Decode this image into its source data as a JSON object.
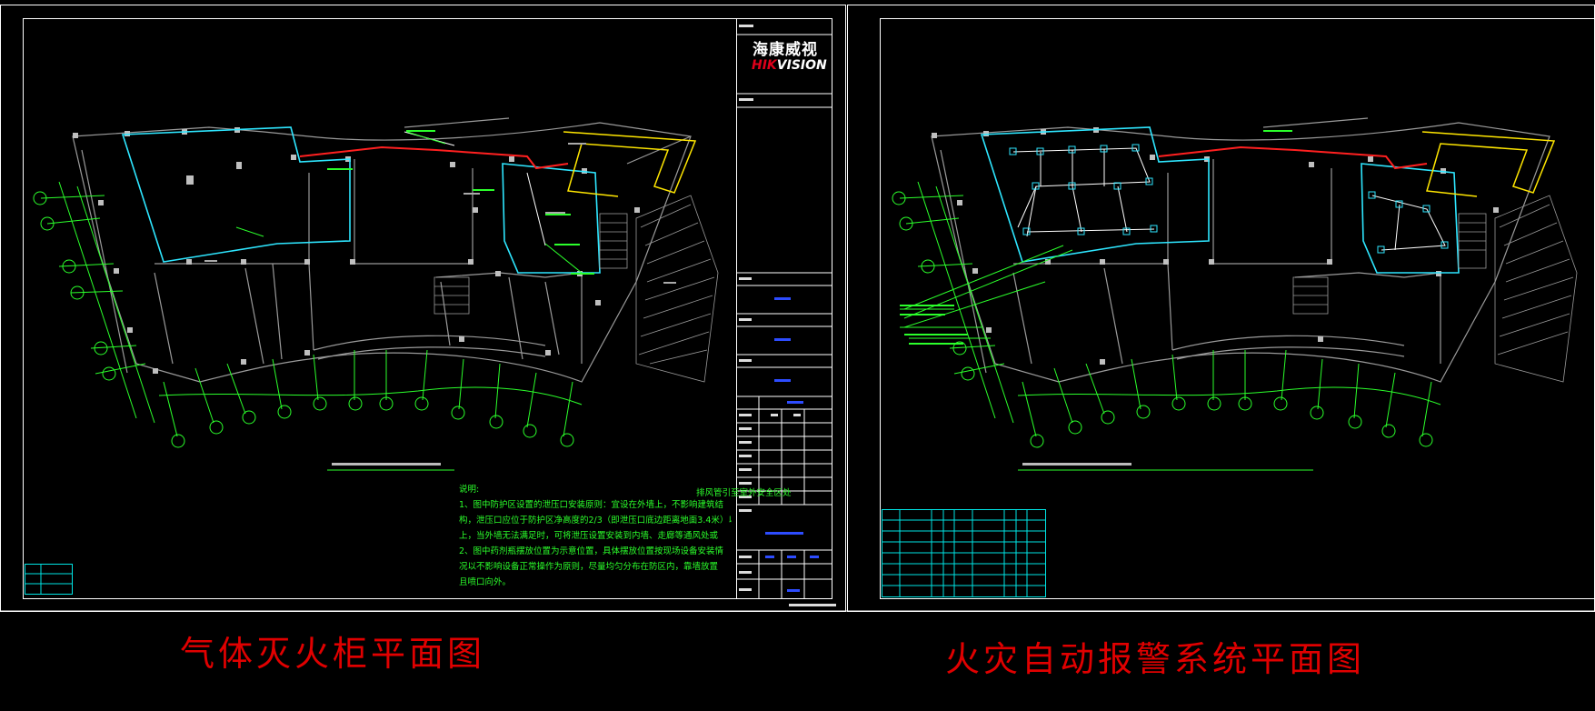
{
  "colors": {
    "background": "#000000",
    "frame": "#ffffff",
    "grid": "#2bff2b",
    "wall": "#9a9a9a",
    "zone": "#2ee6ff",
    "pipe": "#ff2020",
    "duct": "#ffe600",
    "caption": "#e00000",
    "title_block_blue": "#2d4cff",
    "legend": "#00e5e5"
  },
  "captions": {
    "left": "气体灭火柜平面图",
    "right": "火灾自动报警系统平面图"
  },
  "logo": {
    "chinese": "海康威视",
    "english_hik": "HIK",
    "english_vision": "VISION"
  },
  "notes": {
    "heading": "说明:",
    "lines": [
      "1、图中防护区设置的泄压口安装原则：宜设在外墙上，不影响建筑结",
      "构，泄压口应位于防护区净高度的2/3（即泄压口底边距离地面3.4米）以",
      "上，当外墙无法满足时，可将泄压设置安装到内墙、走廊等通风处或",
      "2、图中药剂瓶摆放位置为示意位置，具体摆放位置按现场设备安装情",
      "况以不影响设备正常操作为原则，尽量均匀分布在防区内，靠墙放置",
      "且喷口向外。"
    ],
    "overlap": "排风管引至室外安全区处"
  }
}
